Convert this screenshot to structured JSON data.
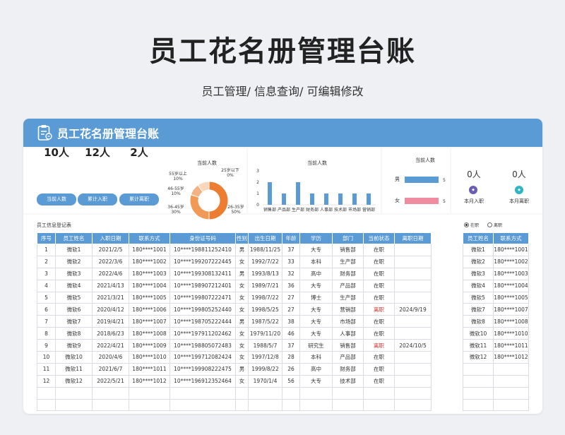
{
  "page": {
    "title": "员工花名册管理台账",
    "subtitle": "员工管理/ 信息查询/ 可编辑修改"
  },
  "card": {
    "header_title": "员工花名册管理台账"
  },
  "stats": [
    {
      "value": "10人",
      "button": "当前人数"
    },
    {
      "value": "12人",
      "button": "累计入职"
    },
    {
      "value": "2人",
      "button": "累计离职"
    }
  ],
  "age_chart": {
    "title": "当前人数",
    "labels": [
      "55岁以上\n10%",
      "25岁以下\n0%",
      "46-55岁\n10%",
      "36-45岁\n30%",
      "26-35岁\n50%"
    ]
  },
  "dept_chart": {
    "title": "当前人数"
  },
  "gender_chart": {
    "title": "当前人数"
  },
  "month": {
    "entry_value": "0人",
    "leave_value": "0人",
    "entry_label": "本月入职",
    "leave_label": "本月离职"
  },
  "colors": {
    "accent": "#5b9bd5",
    "orange": "#ed7d31",
    "pink": "#f08ca0",
    "leave": "#d0312d"
  },
  "chart_data": [
    {
      "type": "pie",
      "title": "当前人数",
      "categories": [
        "25岁以下",
        "26-35岁",
        "36-45岁",
        "46-55岁",
        "55岁以上"
      ],
      "values": [
        0,
        50,
        30,
        10,
        10
      ]
    },
    {
      "type": "bar",
      "title": "当前人数",
      "categories": [
        "销售部",
        "产品部",
        "生产部",
        "财务部",
        "人事部",
        "技术部",
        "市场部",
        "营销部"
      ],
      "values": [
        2,
        1,
        2,
        1,
        1,
        1,
        1,
        1
      ],
      "ylim": [
        0,
        3
      ],
      "yticks": [
        "0",
        "1",
        "2",
        "3"
      ]
    },
    {
      "type": "bar",
      "orientation": "horizontal",
      "title": "当前人数",
      "categories": [
        "男",
        "女"
      ],
      "values": [
        5,
        5
      ],
      "value_labels": [
        "5",
        "5"
      ]
    }
  ],
  "register": {
    "title": "员工信息登记表",
    "columns": [
      "序号",
      "员工姓名",
      "入职日期",
      "联系方式",
      "身份证号码",
      "性别",
      "出生日期",
      "年龄",
      "学历",
      "部门",
      "当前状态",
      "离职日期"
    ],
    "rows": [
      [
        "1",
        "微软1",
        "2021/2/5",
        "180****1001",
        "10****198811252410",
        "男",
        "1988/11/25",
        "37",
        "大专",
        "销售部",
        "在职",
        ""
      ],
      [
        "2",
        "微软2",
        "2022/3/6",
        "180****1002",
        "10****199207222445",
        "女",
        "1992/7/22",
        "33",
        "本科",
        "生产部",
        "在职",
        ""
      ],
      [
        "3",
        "微软3",
        "2022/4/6",
        "180****1003",
        "10****199308132411",
        "男",
        "1993/8/13",
        "32",
        "高中",
        "财务部",
        "在职",
        ""
      ],
      [
        "4",
        "微软4",
        "2021/4/13",
        "180****1004",
        "10****198907212401",
        "女",
        "1989/7/21",
        "36",
        "大专",
        "产品部",
        "在职",
        ""
      ],
      [
        "5",
        "微软5",
        "2021/3/21",
        "180****1005",
        "10****199807222471",
        "女",
        "1998/7/22",
        "27",
        "博士",
        "生产部",
        "在职",
        ""
      ],
      [
        "6",
        "微软6",
        "2020/4/12",
        "180****1006",
        "10****199805252440",
        "女",
        "1998/5/25",
        "27",
        "大专",
        "营销部",
        "离职",
        "2024/9/19"
      ],
      [
        "7",
        "微软7",
        "2019/4/21",
        "180****1007",
        "10****198705222444",
        "男",
        "1987/5/22",
        "38",
        "大专",
        "市场部",
        "在职",
        ""
      ],
      [
        "8",
        "微软8",
        "2018/6/23",
        "180****1008",
        "10****197911202462",
        "女",
        "1979/11/20",
        "46",
        "大专",
        "人事部",
        "在职",
        ""
      ],
      [
        "9",
        "微软9",
        "2022/4/21",
        "180****1009",
        "10****198805072483",
        "女",
        "1988/5/7",
        "37",
        "研究生",
        "销售部",
        "离职",
        "2024/10/5"
      ],
      [
        "10",
        "微软10",
        "2020/4/6",
        "180****1010",
        "10****199712082424",
        "女",
        "1997/12/8",
        "28",
        "本科",
        "产品部",
        "在职",
        ""
      ],
      [
        "11",
        "微软11",
        "2021/6/7",
        "180****1011",
        "10****199908222475",
        "男",
        "1999/8/22",
        "26",
        "高中",
        "财务部",
        "在职",
        ""
      ],
      [
        "12",
        "微软12",
        "2022/5/21",
        "180****1012",
        "10****196912352464",
        "女",
        "1970/1/4",
        "56",
        "大专",
        "技术部",
        "在职",
        ""
      ]
    ]
  },
  "filter": {
    "options": [
      "在职",
      "离职"
    ],
    "selected": "在职",
    "columns": [
      "员工姓名",
      "联系方式"
    ],
    "rows": [
      [
        "微软1",
        "180****1001"
      ],
      [
        "微软2",
        "180****1002"
      ],
      [
        "微软3",
        "180****1003"
      ],
      [
        "微软4",
        "180****1004"
      ],
      [
        "微软5",
        "180****1005"
      ],
      [
        "微软7",
        "180****1007"
      ],
      [
        "微软8",
        "180****1008"
      ],
      [
        "微软10",
        "180****1010"
      ],
      [
        "微软11",
        "180****1011"
      ],
      [
        "微软12",
        "180****1012"
      ]
    ]
  }
}
